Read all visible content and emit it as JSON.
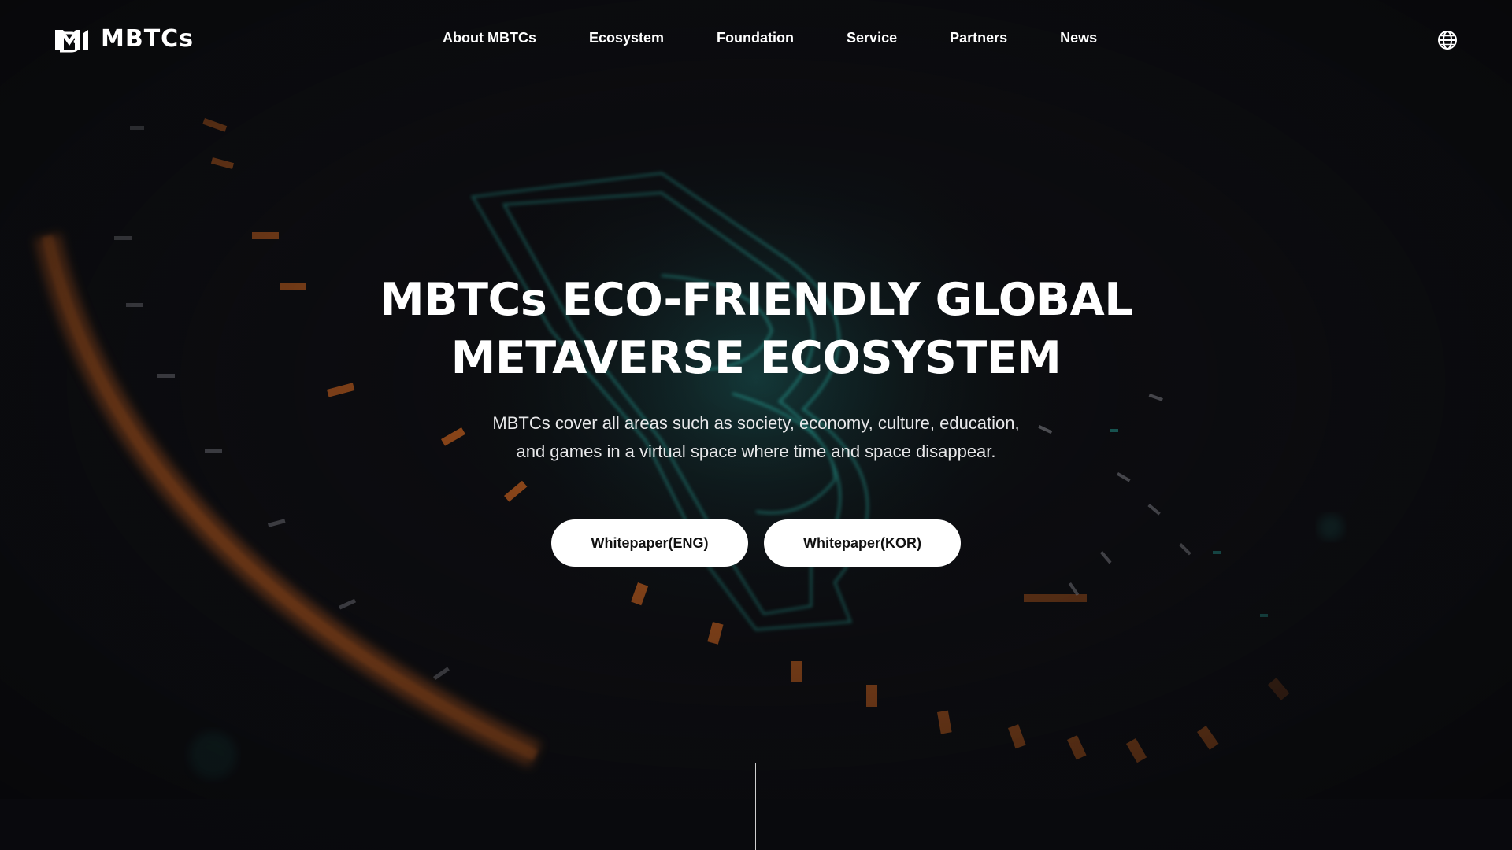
{
  "brand": {
    "name": "MBTCs"
  },
  "nav": {
    "items": [
      {
        "label": "About MBTCs"
      },
      {
        "label": "Ecosystem"
      },
      {
        "label": "Foundation"
      },
      {
        "label": "Service"
      },
      {
        "label": "Partners"
      },
      {
        "label": "News"
      }
    ],
    "language_icon": "globe-icon"
  },
  "hero": {
    "title_line1": "MBTCs ECO-FRIENDLY GLOBAL",
    "title_line2": "METAVERSE ECOSYSTEM",
    "subtitle_line1": "MBTCs cover all areas such as society, economy, culture, education,",
    "subtitle_line2": "and games in a virtual space where time and space disappear.",
    "buttons": {
      "whitepaper_eng": "Whitepaper(ENG)",
      "whitepaper_kor": "Whitepaper(KOR)"
    }
  },
  "colors": {
    "background": "#0b0b0e",
    "accent_teal": "#2fd3c2",
    "accent_orange": "#e06a1e",
    "button_bg": "#ffffff",
    "button_text": "#111111"
  }
}
